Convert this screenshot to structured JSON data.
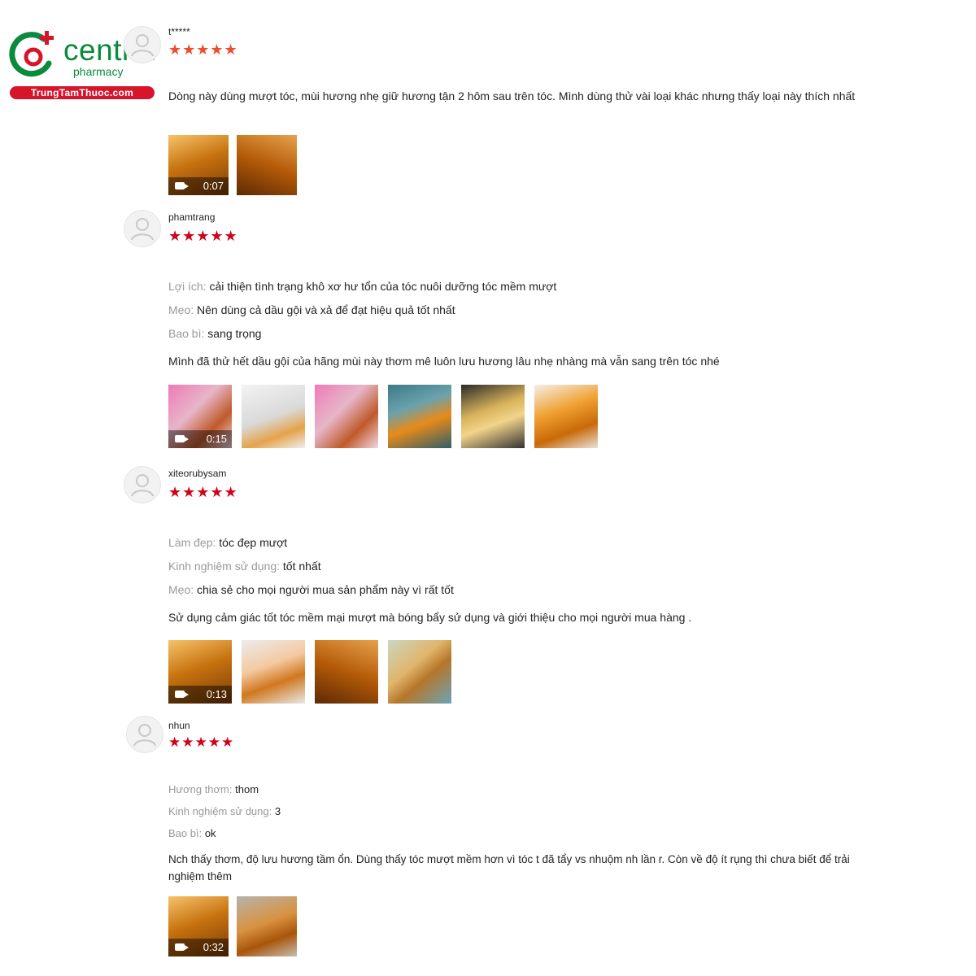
{
  "logo": {
    "wordmark": "central",
    "sub": "pharmacy",
    "url": "TrungTamThuoc.com",
    "brand_green": "#0a8a3c",
    "brand_red": "#d7142a"
  },
  "colors": {
    "star_orange": "#ee4d2d",
    "star_red": "#d0011b"
  },
  "reviews": [
    {
      "username": "t*****",
      "stars": "★★★★★",
      "comment": "Dòng này dùng mượt tóc, mùi hương nhẹ giữ hương tận 2 hôm sau trên tóc. Mình dùng thử vài loại khác nhưng thấy loại này thích nhất",
      "video_duration": "0:07"
    },
    {
      "username": "phamtrang",
      "stars": "★★★★★",
      "attrs": [
        {
          "k": "Lợi ích:",
          "v": "cải thiện tình trạng khô xơ hư tổn của tóc nuôi dưỡng tóc mềm mượt"
        },
        {
          "k": "Mẹo:",
          "v": "Nên dùng cả dầu gội và xả để đạt hiệu quả tốt nhất"
        },
        {
          "k": "Bao bì:",
          "v": "sang trọng"
        }
      ],
      "comment": "Mình đã thử hết dầu gội của hãng mùi này thơm mê luôn lưu hương lâu nhẹ nhàng mà vẫn sang trên tóc nhé",
      "video_duration": "0:15"
    },
    {
      "username": "xiteorubysam",
      "stars": "★★★★★",
      "attrs": [
        {
          "k": "Làm đẹp:",
          "v": "tóc đẹp mượt"
        },
        {
          "k": "Kinh nghiệm sử dụng:",
          "v": "tốt nhất"
        },
        {
          "k": "Mẹo:",
          "v": "chia sẻ cho mọi người mua sản phẩm này vì rất tốt"
        }
      ],
      "comment": "Sử dụng cảm giác tốt  tóc mềm mại mượt mà bóng bẩy sử dụng và giới thiệu cho mọi người mua hàng .",
      "video_duration": "0:13"
    },
    {
      "username": "nhun",
      "stars": "★★★★★",
      "attrs": [
        {
          "k": "Hương thơm:",
          "v": "thom"
        },
        {
          "k": "Kinh nghiệm sử dụng:",
          "v": "3"
        },
        {
          "k": "Bao bì:",
          "v": "ok"
        }
      ],
      "comment": "Nch thấy thơm, độ lưu hương tầm ổn. Dùng thấy tóc mượt mềm hơn vì tóc t đã tẩy vs nhuộm nh lần r. Còn về độ ít rụng thì chưa biết để trải nghiệm thêm",
      "video_duration": "0:32"
    }
  ]
}
